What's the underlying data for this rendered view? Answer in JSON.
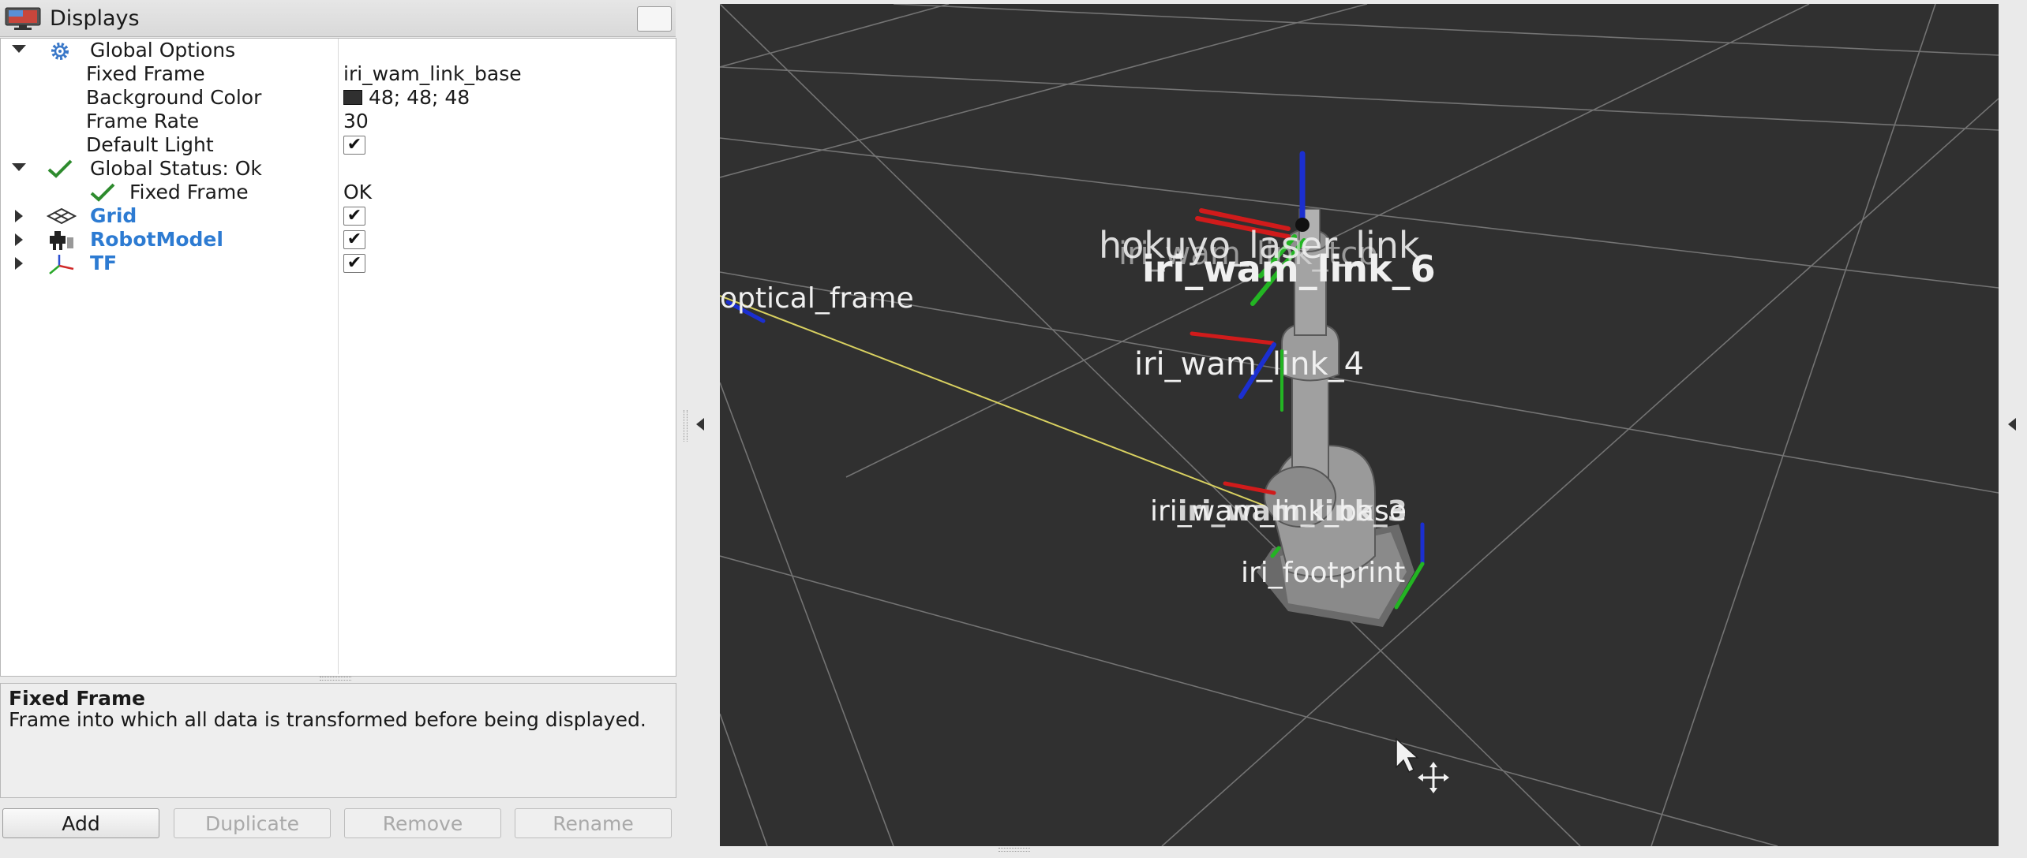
{
  "displays_panel": {
    "title": "Displays",
    "tree": [
      {
        "label": "Global Options",
        "expanded": true,
        "icon": "gear-icon"
      },
      {
        "label": "Fixed Frame",
        "value": "iri_wam_link_base"
      },
      {
        "label": "Background Color",
        "value": "48; 48; 48",
        "color": "#303030"
      },
      {
        "label": "Frame Rate",
        "value": "30"
      },
      {
        "label": "Default Light",
        "checked": true
      },
      {
        "label": "Global Status: Ok",
        "expanded": true,
        "icon": "checkmark-icon"
      },
      {
        "label": "Fixed Frame",
        "value": "OK",
        "icon": "checkmark-icon"
      },
      {
        "label": "Grid",
        "checked": true,
        "icon": "grid-icon"
      },
      {
        "label": "RobotModel",
        "checked": true,
        "icon": "robot-icon"
      },
      {
        "label": "TF",
        "checked": true,
        "icon": "axes-icon"
      }
    ],
    "description": {
      "title": "Fixed Frame",
      "text": "Frame into which all data is transformed before being displayed."
    },
    "buttons": {
      "add": "Add",
      "duplicate": "Duplicate",
      "remove": "Remove",
      "rename": "Rename"
    }
  },
  "viewport": {
    "background": "#303030",
    "tf_labels": {
      "optical": "optical_frame",
      "laser": "hokuyo_laser_link",
      "link_top": "iri_wam_link_tcp",
      "link_6": "iri_wam_link_6",
      "link_4": "iri_wam_link_4",
      "link_base": "iri_wam_link_base",
      "link_3": "iri_wam_link_3",
      "footprint": "iri_footprint"
    }
  }
}
